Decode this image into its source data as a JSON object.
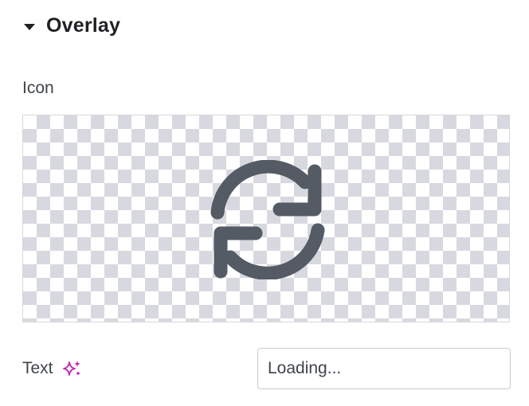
{
  "section": {
    "title": "Overlay",
    "expanded": true
  },
  "icon_field": {
    "label": "Icon",
    "selected_icon": "refresh-icon"
  },
  "text_field": {
    "label": "Text",
    "ai_icon": "sparkles-icon",
    "value": "Loading..."
  },
  "colors": {
    "icon": "#545b64",
    "ai_accent": "#c026b3",
    "checker": "#d8d9e0"
  }
}
